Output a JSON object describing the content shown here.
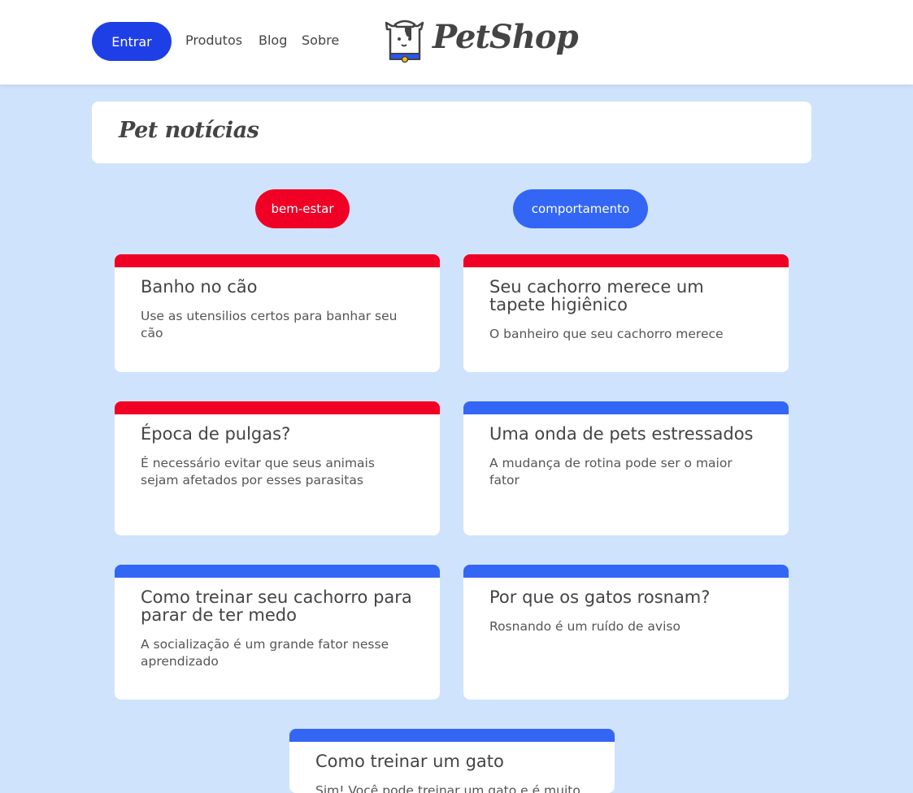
{
  "header": {
    "login_label": "Entrar",
    "nav": [
      "Produtos",
      "Blog",
      "Sobre"
    ],
    "logo_text": "PetShop"
  },
  "page": {
    "title": "Pet notícias"
  },
  "tags": [
    {
      "label": "bem-estar",
      "color": "#f00025"
    },
    {
      "label": "comportamento",
      "color": "#3366f5"
    }
  ],
  "colors": {
    "brand_blue": "#1f3fe6",
    "wellbeing_red": "#f00025",
    "behavior_blue": "#3366f5",
    "page_background": "#cfe3fc"
  },
  "cards": [
    {
      "title": "Banho no cão",
      "description": "Use as utensilios certos para banhar seu cão",
      "category": "bem-estar"
    },
    {
      "title": "Seu cachorro merece um tapete higiênico",
      "description": "O banheiro que seu cachorro merece",
      "category": "bem-estar"
    },
    {
      "title": "Época de pulgas?",
      "description": "É necessário evitar que seus animais sejam afetados por esses parasitas",
      "category": "bem-estar"
    },
    {
      "title": "Uma onda de pets estressados",
      "description": "A mudança de rotina pode ser o maior fator",
      "category": "comportamento"
    },
    {
      "title": "Como treinar seu cachorro para parar de ter medo",
      "description": "A socialização é um grande fator nesse aprendizado",
      "category": "comportamento"
    },
    {
      "title": "Por que os gatos rosnam?",
      "description": "Rosnando é um ruído de aviso",
      "category": "comportamento"
    },
    {
      "title": "Como treinar um gato",
      "description": "Sim! Você pode treinar um gato e é muito",
      "category": "comportamento"
    }
  ]
}
